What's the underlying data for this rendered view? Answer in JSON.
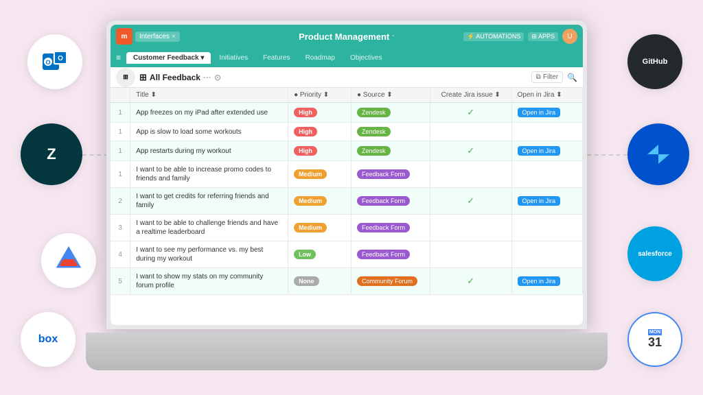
{
  "app": {
    "title": "Product Management",
    "interfaces_label": "Interfaces",
    "close_icon": "×"
  },
  "nav_tabs": [
    {
      "id": "customer-feedback",
      "label": "Customer Feedback",
      "active": true
    },
    {
      "id": "initiatives",
      "label": "Initiatives",
      "active": false
    },
    {
      "id": "features",
      "label": "Features",
      "active": false
    },
    {
      "id": "roadmap",
      "label": "Roadmap",
      "active": false
    },
    {
      "id": "objectives",
      "label": "Objectives",
      "active": false
    }
  ],
  "toolbar": {
    "view_icon": "⊞",
    "view_label": "All Feedback",
    "filter_label": "Filter"
  },
  "table": {
    "columns": [
      {
        "id": "num",
        "label": ""
      },
      {
        "id": "title",
        "label": "Title"
      },
      {
        "id": "priority",
        "label": "Priority"
      },
      {
        "id": "source",
        "label": "Source"
      },
      {
        "id": "create_jira",
        "label": "Create Jira issue"
      },
      {
        "id": "open_jira",
        "label": "Open in Jira"
      }
    ],
    "rows": [
      {
        "num": "1",
        "title": "App freezes on my iPad after extended use",
        "priority": "High",
        "priority_class": "priority-high",
        "source": "Zendesk",
        "source_class": "source-zendesk",
        "has_check": true,
        "has_jira": true,
        "highlighted": true
      },
      {
        "num": "1",
        "title": "App is slow to load some workouts",
        "priority": "High",
        "priority_class": "priority-high",
        "source": "Zendesk",
        "source_class": "source-zendesk",
        "has_check": false,
        "has_jira": false,
        "highlighted": false
      },
      {
        "num": "1",
        "title": "App restarts during my workout",
        "priority": "High",
        "priority_class": "priority-high",
        "source": "Zendesk",
        "source_class": "source-zendesk",
        "has_check": true,
        "has_jira": true,
        "highlighted": true
      },
      {
        "num": "1",
        "title": "I want to be able to increase promo codes to friends and family",
        "priority": "Medium",
        "priority_class": "priority-medium",
        "source": "Feedback Form",
        "source_class": "source-feedback",
        "has_check": false,
        "has_jira": false,
        "highlighted": false
      },
      {
        "num": "2",
        "title": "I want to get credits for referring friends and family",
        "priority": "Medium",
        "priority_class": "priority-medium",
        "source": "Feedback Form",
        "source_class": "source-feedback",
        "has_check": true,
        "has_jira": true,
        "highlighted": true
      },
      {
        "num": "3",
        "title": "I want to be able to challenge friends and have a realtime leaderboard",
        "priority": "Medium",
        "priority_class": "priority-medium",
        "source": "Feedback Form",
        "source_class": "source-feedback",
        "has_check": false,
        "has_jira": false,
        "highlighted": false
      },
      {
        "num": "4",
        "title": "I want to see my performance vs. my best during my workout",
        "priority": "Low",
        "priority_class": "priority-low",
        "source": "Feedback Form",
        "source_class": "source-feedback",
        "has_check": false,
        "has_jira": false,
        "highlighted": false
      },
      {
        "num": "5",
        "title": "I want to show my stats on my community forum profile",
        "priority": "None",
        "priority_class": "priority-none",
        "source": "Community Forum",
        "source_class": "source-community",
        "has_check": true,
        "has_jira": true,
        "highlighted": true
      }
    ]
  },
  "integrations": [
    {
      "id": "outlook",
      "label": "✉",
      "bg": "#0072c6",
      "color": "white"
    },
    {
      "id": "zendesk",
      "label": "Z",
      "bg": "#03363D",
      "color": "white"
    },
    {
      "id": "gdrive",
      "label": "▲",
      "bg": "white",
      "color": "#4285F4"
    },
    {
      "id": "box",
      "label": "box",
      "bg": "white",
      "color": "#0061D5"
    },
    {
      "id": "github",
      "label": "GitHub",
      "bg": "#24292e",
      "color": "white"
    },
    {
      "id": "jira",
      "label": "◆",
      "bg": "#0052CC",
      "color": "white"
    },
    {
      "id": "salesforce",
      "label": "sf",
      "bg": "#00A1E0",
      "color": "white"
    },
    {
      "id": "gcal",
      "label": "31",
      "bg": "#4285F4",
      "color": "white"
    }
  ],
  "open_jira_label": "Open in Jira",
  "automations_label": "⚡ AUTOMATIONS",
  "apps_label": "⊞ APPS"
}
